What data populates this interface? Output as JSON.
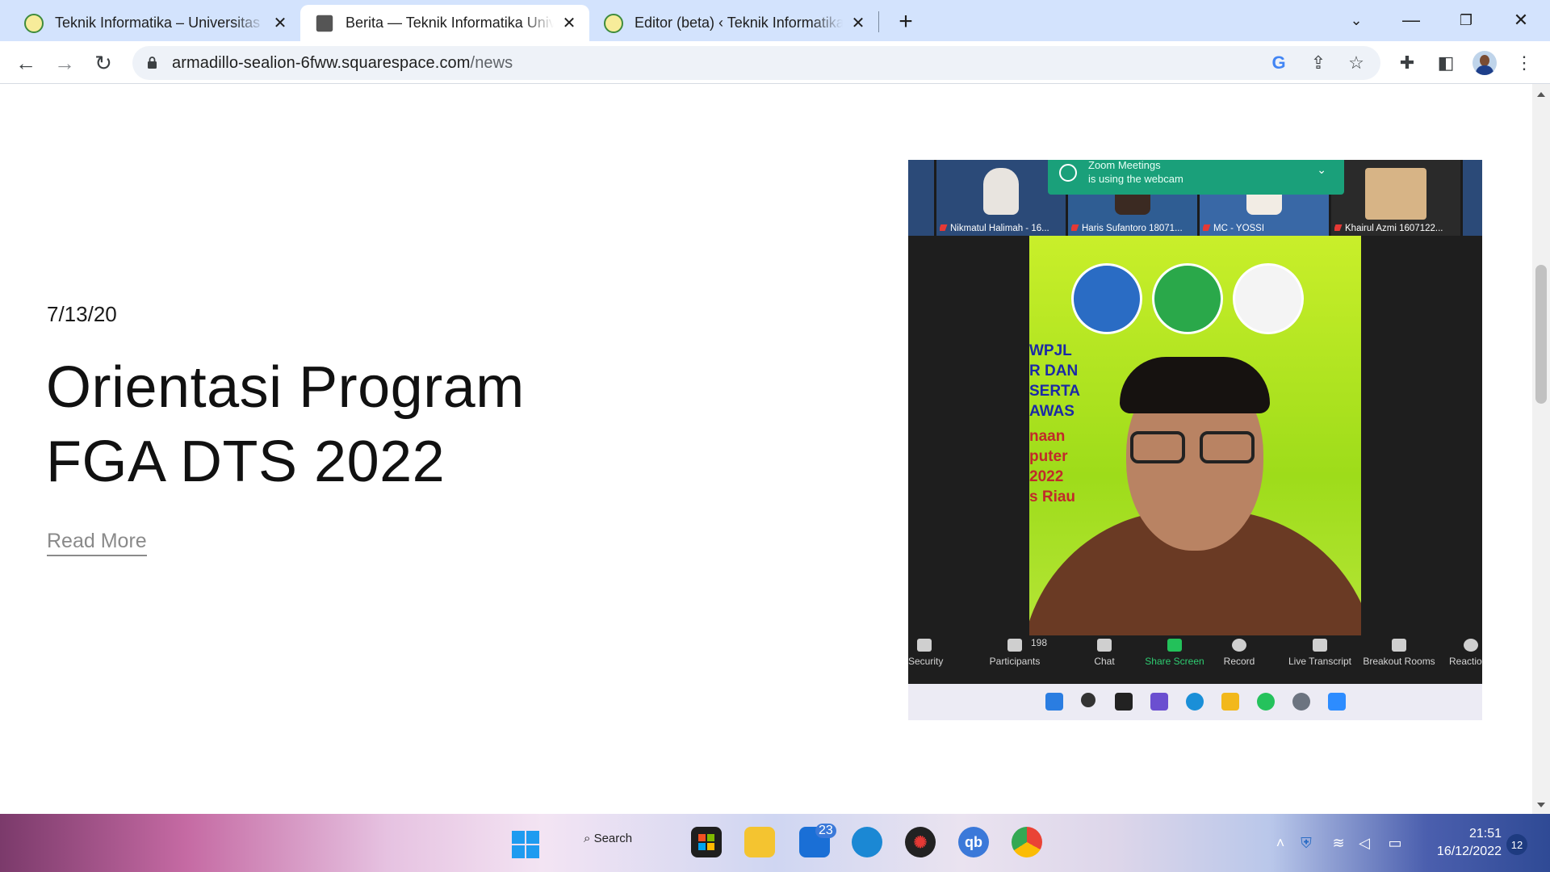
{
  "browser": {
    "tabs": [
      {
        "title": "Teknik Informatika – Universitas Riau",
        "active": false,
        "favicon": "university-icon"
      },
      {
        "title": "Berita — Teknik Informatika Universitas Riau",
        "active": true,
        "favicon": "squarespace-icon"
      },
      {
        "title": "Editor (beta) ‹ Teknik Informatika",
        "active": false,
        "favicon": "university-icon"
      }
    ],
    "url_host": "armadillo-sealion-6fww.squarespace.com",
    "url_path": "/news"
  },
  "article": {
    "date": "7/13/20",
    "title_line1": "Orientasi Program",
    "title_line2": "FGA DTS 2022",
    "read_more": "Read More"
  },
  "zoom": {
    "notification_line1": "Zoom Meetings",
    "notification_line2": "is using the webcam",
    "participants": [
      {
        "name": "Nikmatul Halimah - 16..."
      },
      {
        "name": "Haris Sufantoro 18071..."
      },
      {
        "name": "MC - YOSSI"
      },
      {
        "name": "Khairul Azmi 1607122..."
      }
    ],
    "banner_lines": [
      "WPJL",
      "R DAN",
      "SERTA",
      "AWAS"
    ],
    "banner_red_lines": [
      "naan",
      "puter",
      "2022",
      "s Riau"
    ],
    "controls": {
      "security": "Security",
      "participants": "Participants",
      "participants_count": "198",
      "chat": "Chat",
      "share_screen": "Share Screen",
      "record": "Record",
      "live_transcript": "Live Transcript",
      "breakout_rooms": "Breakout Rooms",
      "reactions": "Reactio"
    }
  },
  "taskbar": {
    "search": "Search",
    "mail_badge": "23",
    "time": "21:51",
    "date": "16/12/2022",
    "notifications": "12"
  },
  "colors": {
    "tabstrip": "#d3e3fd",
    "zoom_notification": "#1aa07a",
    "slide_background": "#b5e537"
  }
}
